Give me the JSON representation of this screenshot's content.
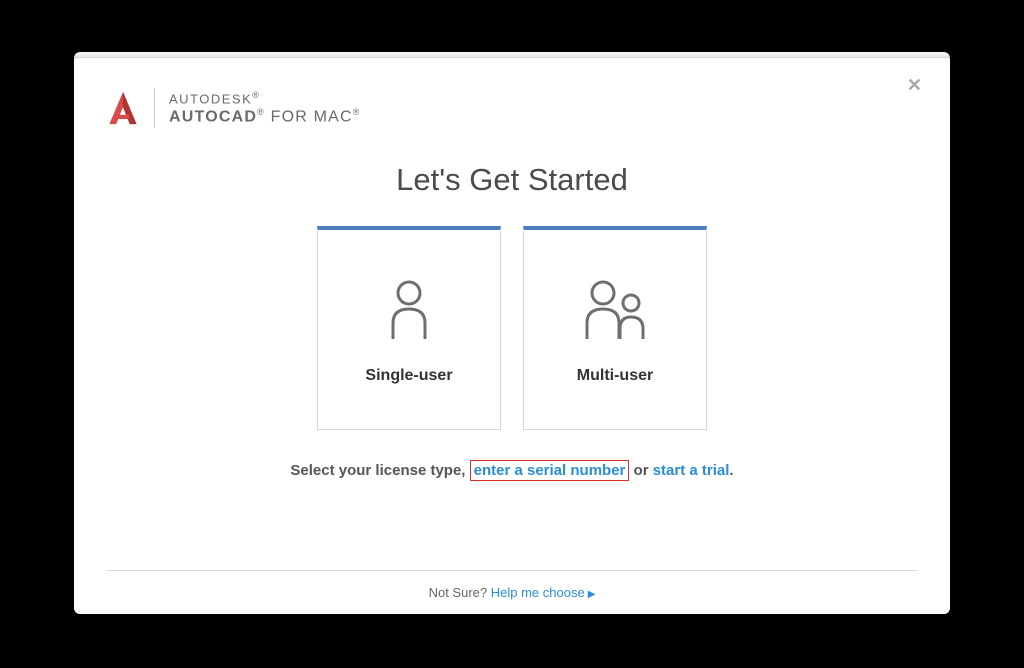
{
  "brand": {
    "company": "AUTODESK",
    "product_bold": "AUTOCAD",
    "product_light": " FOR MAC"
  },
  "heading": "Let's Get Started",
  "cards": {
    "single": "Single-user",
    "multi": "Multi-user"
  },
  "instruction": {
    "prefix": "Select your license type,",
    "serial_link": "enter a serial number",
    "middle": " or ",
    "trial_link": "start a trial",
    "suffix": "."
  },
  "footer": {
    "prefix": "Not Sure? ",
    "link": "Help me choose"
  }
}
